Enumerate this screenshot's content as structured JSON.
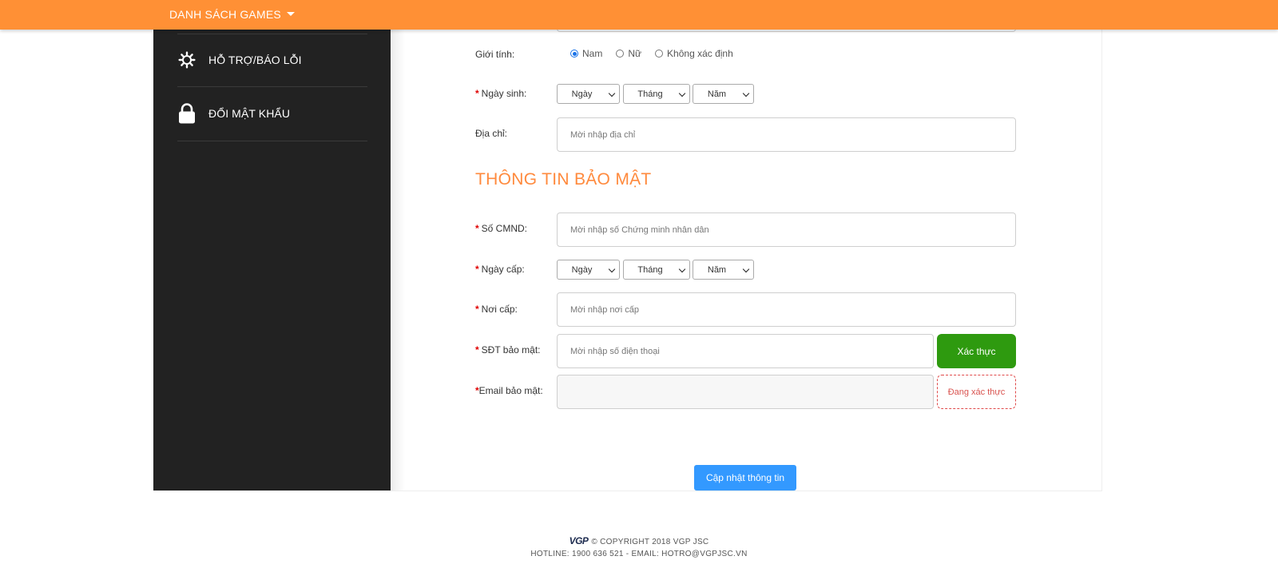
{
  "topbar": {
    "games_label": "DANH SÁCH GAMES"
  },
  "sidebar": {
    "items": [
      {
        "label": "HỖ TRỢ/BÁO LỖI",
        "icon": "gear-icon"
      },
      {
        "label": "ĐỔI MẬT KHẨU",
        "icon": "lock-icon"
      }
    ]
  },
  "form": {
    "gender": {
      "label": "Giới tính:",
      "options": [
        "Nam",
        "Nữ",
        "Không xác định"
      ],
      "selected": "Nam"
    },
    "birthday": {
      "label": "Ngày sinh:",
      "day": "Ngày",
      "month": "Tháng",
      "year": "Năm"
    },
    "address": {
      "label": "Địa chỉ:",
      "placeholder": "Mời nhập địa chỉ",
      "value": ""
    },
    "security_title": "THÔNG TIN BẢO MẬT",
    "id_number": {
      "label": "Số CMND:",
      "placeholder": "Mời nhập số Chứng minh nhân dân"
    },
    "issue_date": {
      "label": "Ngày cấp:",
      "day": "Ngày",
      "month": "Tháng",
      "year": "Năm"
    },
    "issue_place": {
      "label": "Nơi cấp:",
      "placeholder": "Mời nhập nơi cấp"
    },
    "security_phone": {
      "label": "SĐT bảo mật:",
      "placeholder": "Mời nhập số điện thoại",
      "button": "Xác thực"
    },
    "security_email": {
      "label": "Email bảo mật:",
      "status": "Đang xác thực"
    },
    "submit_label": "Cập nhật thông tin"
  },
  "footer": {
    "logo": "VGP",
    "copyright": "© COPYRIGHT 2018 VGP JSC",
    "contact": "HOTLINE: 1900 636 521 - EMAIL: HOTRO@VGPJSC.VN"
  },
  "colors": {
    "topbar": "#ff9035",
    "sidebar": "#222222",
    "section_title": "#ff8a3d",
    "verify_button": "#2e9a0f",
    "update_button": "#3399ff",
    "required": "#e00000"
  }
}
